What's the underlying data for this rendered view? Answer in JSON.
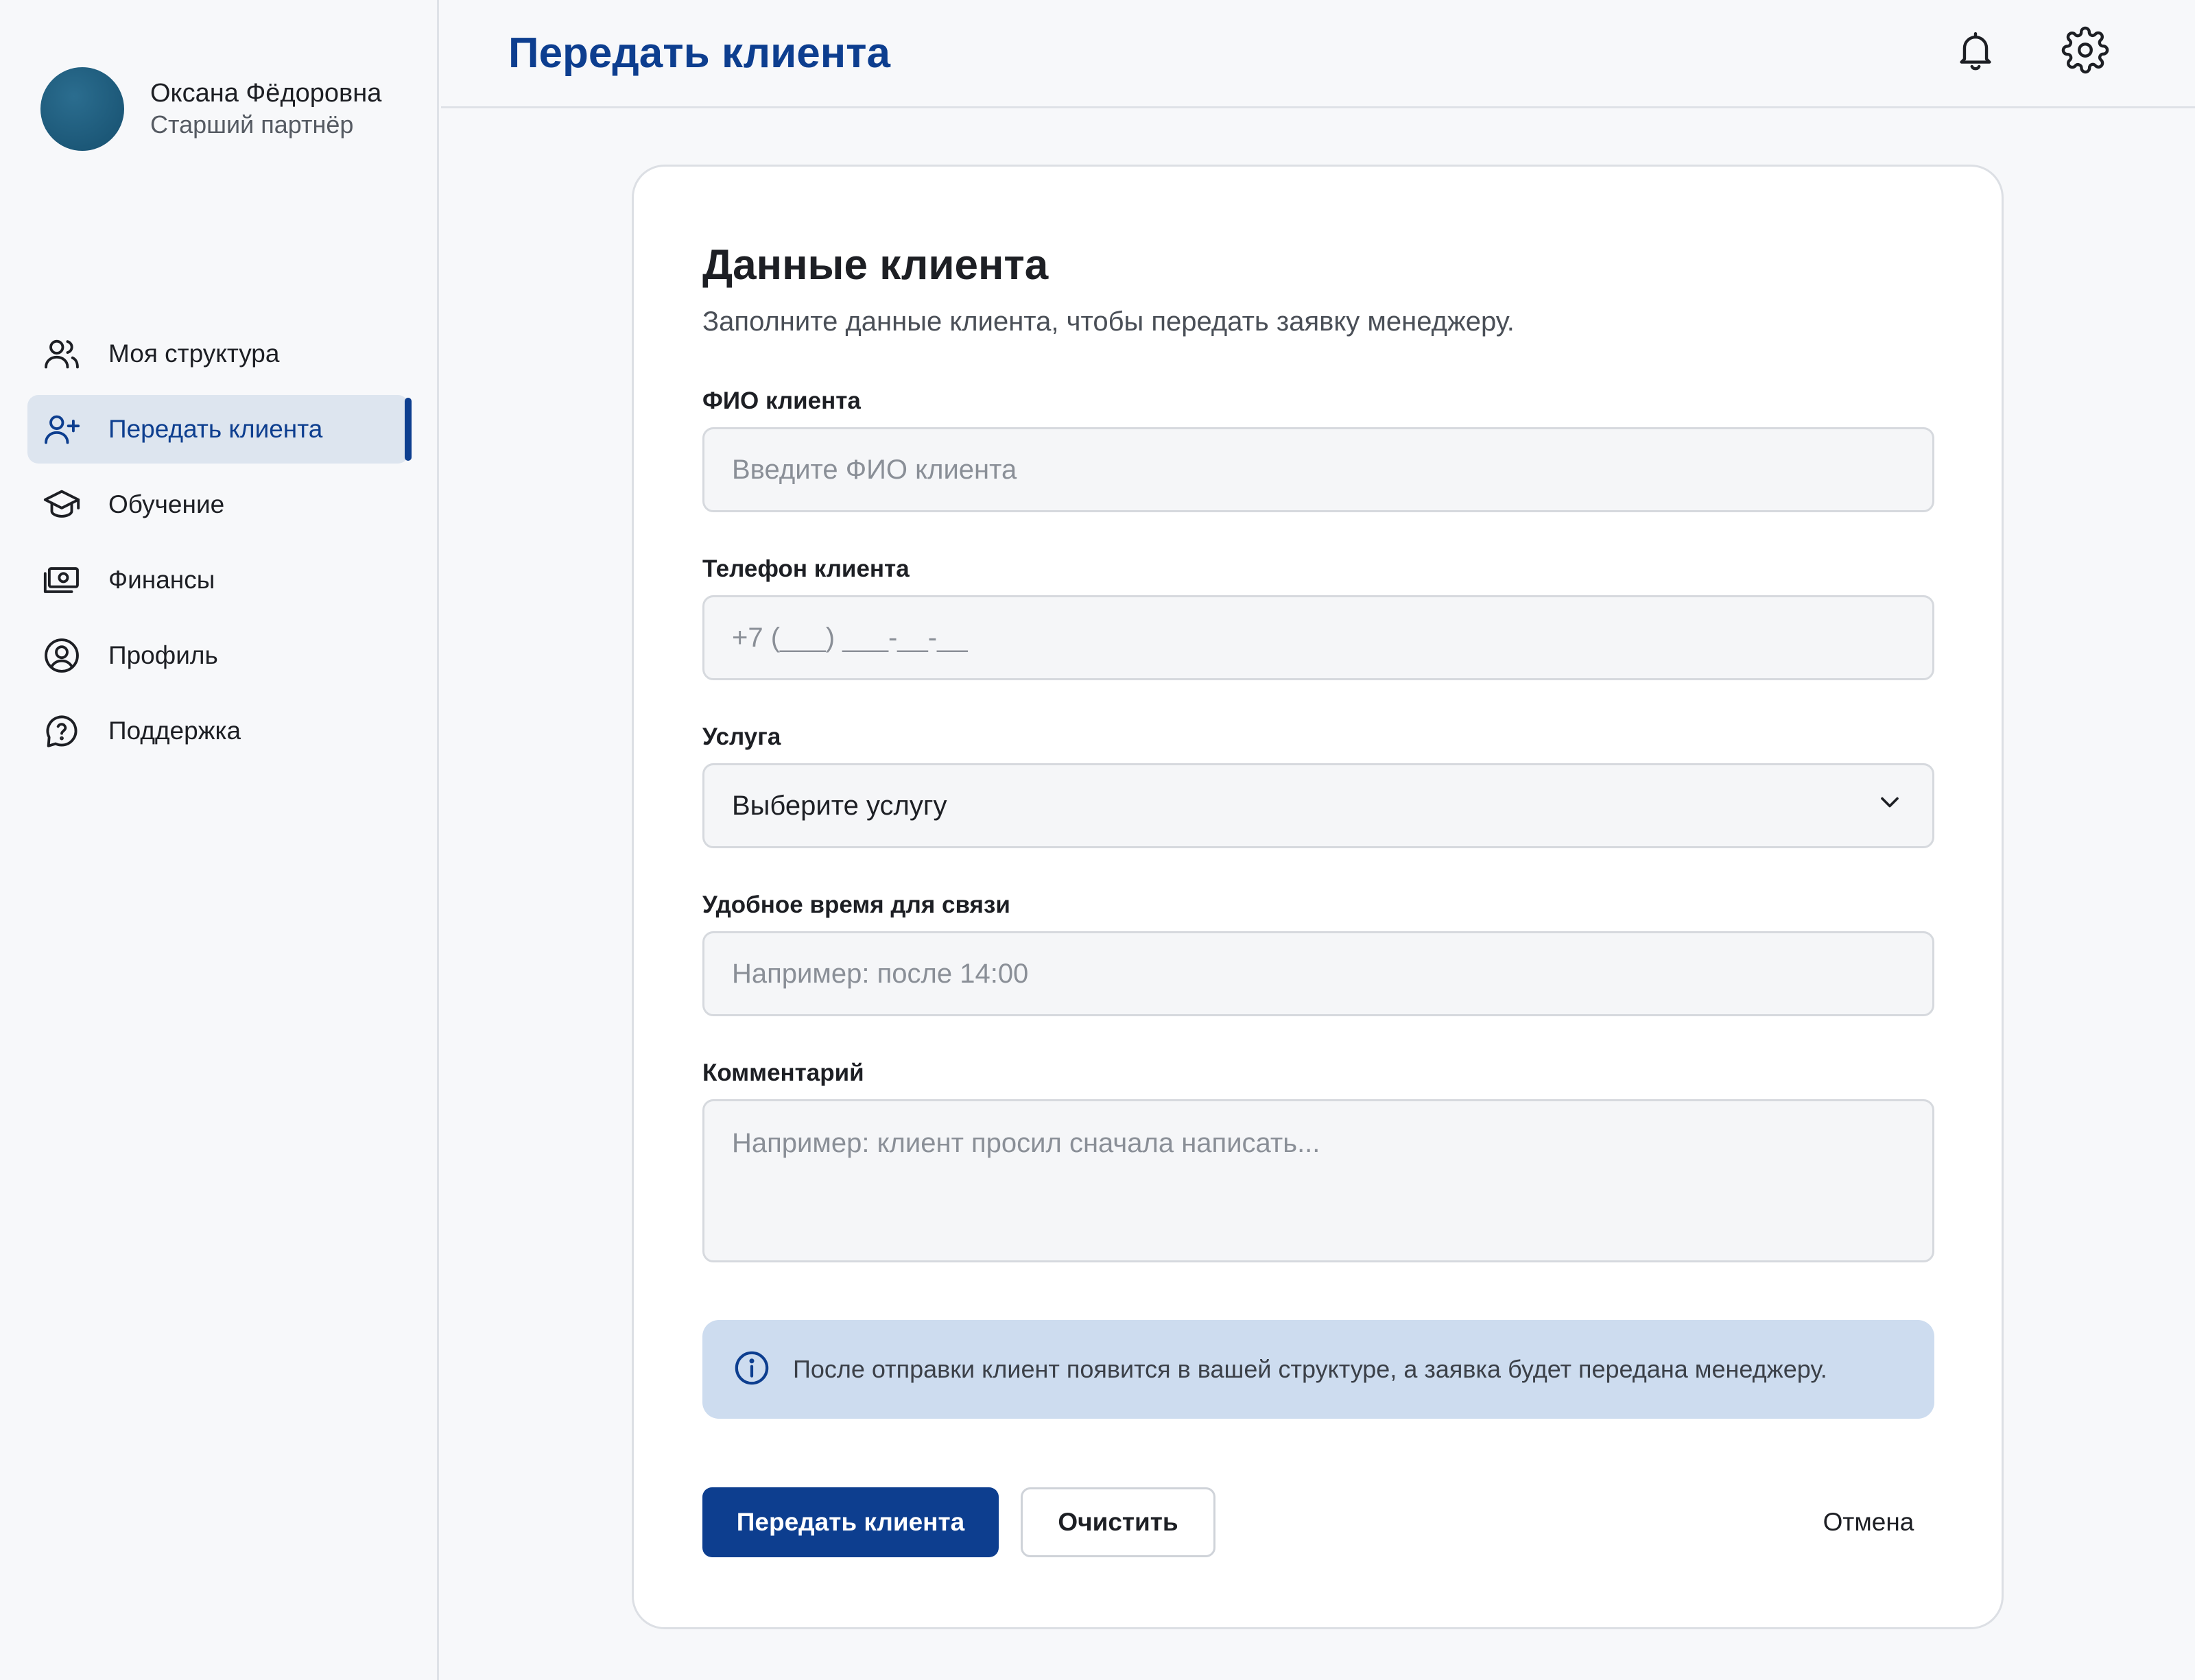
{
  "user": {
    "name": "Оксана Фёдоровна",
    "role": "Старший партнёр"
  },
  "sidebar": {
    "items": [
      {
        "label": "Моя структура",
        "icon": "users-icon",
        "active": false
      },
      {
        "label": "Передать клиента",
        "icon": "user-plus-icon",
        "active": true
      },
      {
        "label": "Обучение",
        "icon": "graduation-cap-icon",
        "active": false
      },
      {
        "label": "Финансы",
        "icon": "money-icon",
        "active": false
      },
      {
        "label": "Профиль",
        "icon": "user-circle-icon",
        "active": false
      },
      {
        "label": "Поддержка",
        "icon": "help-circle-icon",
        "active": false
      }
    ]
  },
  "header": {
    "title": "Передать клиента",
    "icons": [
      "bell-icon",
      "gear-icon"
    ]
  },
  "form": {
    "title": "Данные клиента",
    "subtitle": "Заполните данные клиента, чтобы передать заявку менеджеру.",
    "name_label": "ФИО клиента",
    "name_placeholder": "Введите ФИО клиента",
    "name_value": "",
    "phone_label": "Телефон клиента",
    "phone_placeholder": "+7 (___) ___-__-__",
    "phone_value": "",
    "service_label": "Услуга",
    "service_value": "Выберите услугу",
    "time_label": "Удобное время для связи",
    "time_placeholder": "Например: после 14:00",
    "time_value": "",
    "comment_label": "Комментарий",
    "comment_placeholder": "Например: клиент просил сначала написать...",
    "comment_value": "",
    "info_text": "После отправки клиент появится в вашей структуре, а заявка будет передана менеджеру.",
    "submit_label": "Передать клиента",
    "clear_label": "Очистить",
    "cancel_label": "Отмена"
  },
  "colors": {
    "accent": "#0d3e8f",
    "active_bg": "#dde5ef",
    "info_bg": "#cddcef",
    "avatar": "#1c5878"
  }
}
